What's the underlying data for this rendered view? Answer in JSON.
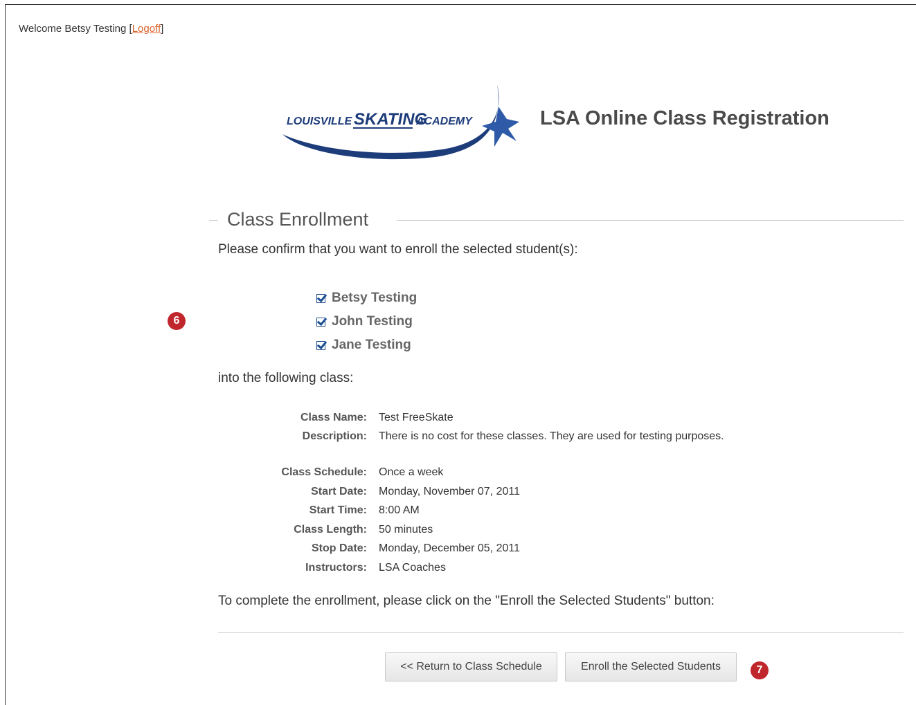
{
  "header": {
    "welcome_prefix": "Welcome Betsy Testing [",
    "logoff_label": "Logoff",
    "welcome_suffix": "]"
  },
  "logo": {
    "text_part1": "LOUISVILLE",
    "text_part2": "SKATING",
    "text_part3": "ACADEMY"
  },
  "app_title": "LSA Online Class Registration",
  "section_title": "Class Enrollment",
  "intro_text": "Please confirm that you want to enroll the selected student(s):",
  "students": [
    {
      "name": "Betsy Testing",
      "checked": true
    },
    {
      "name": "John Testing",
      "checked": true
    },
    {
      "name": "Jane Testing",
      "checked": true
    }
  ],
  "into_text": "into the following class:",
  "class_details": {
    "class_name_label": "Class Name:",
    "class_name": "Test FreeSkate",
    "description_label": "Description:",
    "description": "There is no cost for these classes. They are used for testing purposes.",
    "schedule_label": "Class Schedule:",
    "schedule": "Once a week",
    "start_date_label": "Start Date:",
    "start_date": "Monday, November 07, 2011",
    "start_time_label": "Start Time:",
    "start_time": "8:00 AM",
    "length_label": "Class Length:",
    "length": "50 minutes",
    "stop_date_label": "Stop Date:",
    "stop_date": "Monday, December 05, 2011",
    "instructors_label": "Instructors:",
    "instructors": "LSA Coaches"
  },
  "complete_text": "To complete the enrollment, please click on the \"Enroll the Selected Students\" button:",
  "buttons": {
    "return_label": "<< Return to Class Schedule",
    "enroll_label": "Enroll the Selected Students"
  },
  "markers": {
    "m6": "6",
    "m7": "7"
  },
  "colors": {
    "marker": "#c0272d",
    "link": "#d9622b",
    "logo_navy": "#1d3c7a"
  }
}
